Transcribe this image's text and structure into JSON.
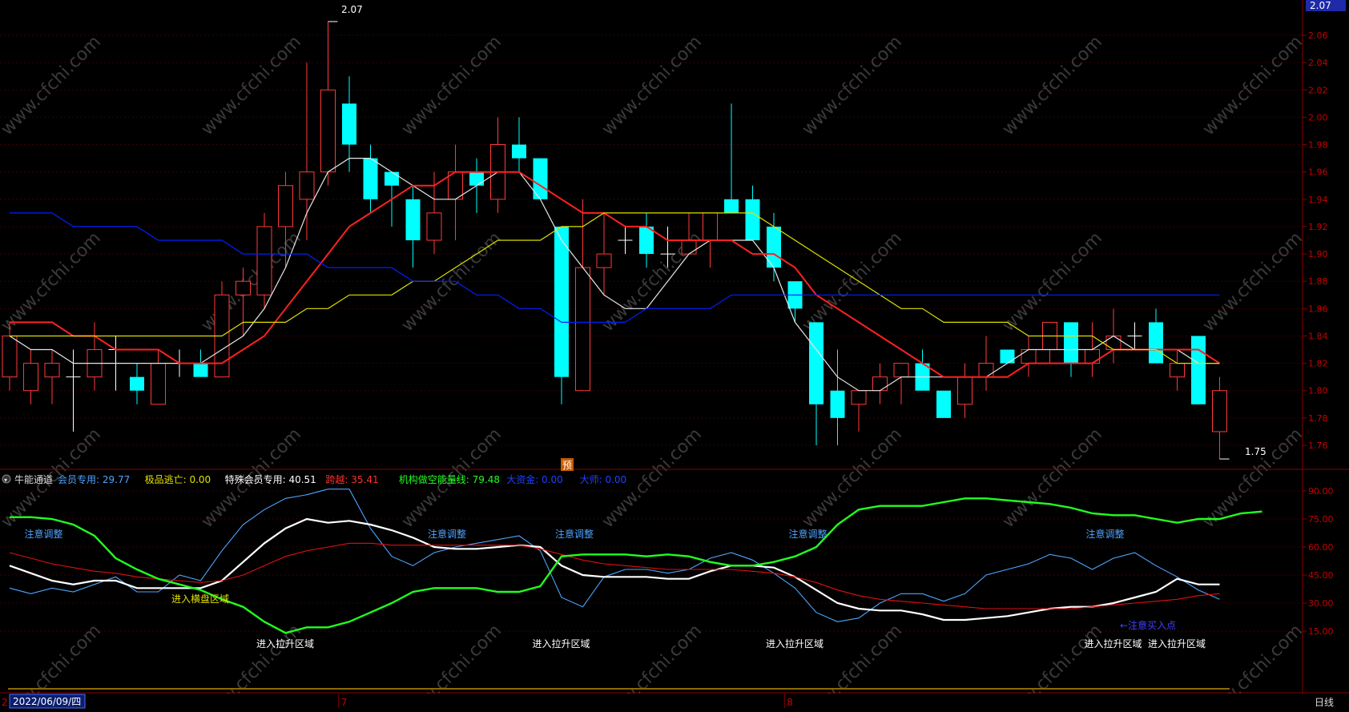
{
  "colors": {
    "bg": "#000000",
    "grid": "#3a0000",
    "frame": "#8a0000",
    "axis_text": "#c80000",
    "up_candle": "#ff3a3a",
    "down_candle": "#00ffff",
    "ma_white": "#e6e6e6",
    "ma_red": "#ff2020",
    "ma_yellow": "#e0e000",
    "ma_blue": "#0020ff",
    "osc_green": "#20ff20",
    "osc_blue": "#4da6ff",
    "osc_white": "#ffffff",
    "osc_red": "#e01010",
    "label_cyan": "#4ea3ff",
    "label_white": "#ffffff",
    "label_yellow": "#e0e000"
  },
  "top_right_price_tag": "2.07",
  "max_marker": "2.07",
  "min_marker": "1.75",
  "forecast_badge": "预",
  "indicator_bar": {
    "name": "牛能通道",
    "items": [
      {
        "label": "会员专用:",
        "value": "29.77",
        "color": "#4ea3ff"
      },
      {
        "label": "极品逃亡:",
        "value": "0.00",
        "color": "#e0e000"
      },
      {
        "label": "特殊会员专用:",
        "value": "40.51",
        "color": "#ffffff"
      },
      {
        "label": "跨越:",
        "value": "35.41",
        "color": "#ff3030"
      },
      {
        "label": "机构做空能量线:",
        "value": "79.48",
        "color": "#20ff20"
      },
      {
        "label": "大资金:",
        "value": "0.00",
        "color": "#2040ff"
      },
      {
        "label": "大师:",
        "value": "0.00",
        "color": "#2040ff"
      }
    ]
  },
  "date_box": "2022/06/09/四",
  "bottom_left_mark": "2",
  "month_labels": [
    {
      "label": "7",
      "index": 16
    },
    {
      "label": "8",
      "index": 37
    }
  ],
  "period_label": "日线",
  "annotations": {
    "attention": "注意调整",
    "enter_lift": "进入拉升区域",
    "enter_sideways": "进入横盘区域",
    "buy_point": "注意买入点"
  },
  "annotation_positions": {
    "attention_at": [
      1,
      20,
      26,
      37,
      51
    ],
    "enter_lift_at": [
      12,
      25,
      36,
      51,
      54
    ],
    "enter_sideways_at": [
      8
    ],
    "buy_point_at": [
      54
    ]
  },
  "watermark": "www.cfchi.com",
  "chart_data": [
    {
      "type": "candlestick",
      "title": "",
      "ylim": [
        1.75,
        2.07
      ],
      "yticks": [
        "2.06",
        "2.04",
        "2.02",
        "2.00",
        "1.98",
        "1.96",
        "1.94",
        "1.92",
        "1.90",
        "1.88",
        "1.86",
        "1.84",
        "1.82",
        "1.80",
        "1.78",
        "1.76"
      ],
      "candles": [
        {
          "o": 1.81,
          "h": 1.85,
          "l": 1.8,
          "c": 1.84
        },
        {
          "o": 1.8,
          "h": 1.83,
          "l": 1.79,
          "c": 1.82
        },
        {
          "o": 1.81,
          "h": 1.83,
          "l": 1.79,
          "c": 1.82
        },
        {
          "o": 1.81,
          "h": 1.83,
          "l": 1.77,
          "c": 1.81
        },
        {
          "o": 1.81,
          "h": 1.85,
          "l": 1.8,
          "c": 1.83
        },
        {
          "o": 1.83,
          "h": 1.84,
          "l": 1.8,
          "c": 1.83
        },
        {
          "o": 1.81,
          "h": 1.82,
          "l": 1.79,
          "c": 1.8
        },
        {
          "o": 1.79,
          "h": 1.83,
          "l": 1.79,
          "c": 1.82
        },
        {
          "o": 1.82,
          "h": 1.83,
          "l": 1.81,
          "c": 1.82
        },
        {
          "o": 1.82,
          "h": 1.83,
          "l": 1.81,
          "c": 1.81
        },
        {
          "o": 1.81,
          "h": 1.88,
          "l": 1.81,
          "c": 1.87
        },
        {
          "o": 1.87,
          "h": 1.89,
          "l": 1.84,
          "c": 1.88
        },
        {
          "o": 1.87,
          "h": 1.93,
          "l": 1.86,
          "c": 1.92
        },
        {
          "o": 1.92,
          "h": 1.96,
          "l": 1.89,
          "c": 1.95
        },
        {
          "o": 1.94,
          "h": 2.04,
          "l": 1.91,
          "c": 1.96
        },
        {
          "o": 1.96,
          "h": 2.07,
          "l": 1.95,
          "c": 2.02
        },
        {
          "o": 2.01,
          "h": 2.03,
          "l": 1.96,
          "c": 1.98
        },
        {
          "o": 1.97,
          "h": 1.98,
          "l": 1.93,
          "c": 1.94
        },
        {
          "o": 1.96,
          "h": 1.96,
          "l": 1.92,
          "c": 1.95
        },
        {
          "o": 1.94,
          "h": 1.95,
          "l": 1.89,
          "c": 1.91
        },
        {
          "o": 1.91,
          "h": 1.96,
          "l": 1.9,
          "c": 1.93
        },
        {
          "o": 1.94,
          "h": 1.98,
          "l": 1.91,
          "c": 1.96
        },
        {
          "o": 1.96,
          "h": 1.97,
          "l": 1.93,
          "c": 1.95
        },
        {
          "o": 1.94,
          "h": 2.0,
          "l": 1.93,
          "c": 1.98
        },
        {
          "o": 1.98,
          "h": 2.0,
          "l": 1.96,
          "c": 1.97
        },
        {
          "o": 1.97,
          "h": 1.97,
          "l": 1.94,
          "c": 1.94
        },
        {
          "o": 1.92,
          "h": 1.92,
          "l": 1.79,
          "c": 1.81
        },
        {
          "o": 1.8,
          "h": 1.94,
          "l": 1.8,
          "c": 1.89
        },
        {
          "o": 1.89,
          "h": 1.93,
          "l": 1.87,
          "c": 1.9
        },
        {
          "o": 1.91,
          "h": 1.92,
          "l": 1.9,
          "c": 1.91
        },
        {
          "o": 1.92,
          "h": 1.93,
          "l": 1.89,
          "c": 1.9
        },
        {
          "o": 1.9,
          "h": 1.92,
          "l": 1.89,
          "c": 1.9
        },
        {
          "o": 1.9,
          "h": 1.93,
          "l": 1.9,
          "c": 1.91
        },
        {
          "o": 1.91,
          "h": 1.93,
          "l": 1.89,
          "c": 1.93
        },
        {
          "o": 1.94,
          "h": 2.01,
          "l": 1.93,
          "c": 1.93
        },
        {
          "o": 1.94,
          "h": 1.95,
          "l": 1.91,
          "c": 1.91
        },
        {
          "o": 1.92,
          "h": 1.93,
          "l": 1.88,
          "c": 1.89
        },
        {
          "o": 1.88,
          "h": 1.88,
          "l": 1.85,
          "c": 1.86
        },
        {
          "o": 1.85,
          "h": 1.85,
          "l": 1.76,
          "c": 1.79
        },
        {
          "o": 1.8,
          "h": 1.83,
          "l": 1.76,
          "c": 1.78
        },
        {
          "o": 1.79,
          "h": 1.8,
          "l": 1.77,
          "c": 1.8
        },
        {
          "o": 1.8,
          "h": 1.82,
          "l": 1.79,
          "c": 1.81
        },
        {
          "o": 1.81,
          "h": 1.82,
          "l": 1.79,
          "c": 1.82
        },
        {
          "o": 1.82,
          "h": 1.83,
          "l": 1.8,
          "c": 1.8
        },
        {
          "o": 1.8,
          "h": 1.8,
          "l": 1.78,
          "c": 1.78
        },
        {
          "o": 1.79,
          "h": 1.82,
          "l": 1.78,
          "c": 1.81
        },
        {
          "o": 1.81,
          "h": 1.84,
          "l": 1.8,
          "c": 1.82
        },
        {
          "o": 1.83,
          "h": 1.83,
          "l": 1.82,
          "c": 1.82
        },
        {
          "o": 1.82,
          "h": 1.84,
          "l": 1.81,
          "c": 1.83
        },
        {
          "o": 1.83,
          "h": 1.85,
          "l": 1.82,
          "c": 1.85
        },
        {
          "o": 1.85,
          "h": 1.85,
          "l": 1.81,
          "c": 1.82
        },
        {
          "o": 1.82,
          "h": 1.85,
          "l": 1.81,
          "c": 1.83
        },
        {
          "o": 1.83,
          "h": 1.86,
          "l": 1.82,
          "c": 1.84
        },
        {
          "o": 1.84,
          "h": 1.85,
          "l": 1.83,
          "c": 1.84
        },
        {
          "o": 1.85,
          "h": 1.86,
          "l": 1.82,
          "c": 1.82
        },
        {
          "o": 1.81,
          "h": 1.83,
          "l": 1.8,
          "c": 1.82
        },
        {
          "o": 1.84,
          "h": 1.84,
          "l": 1.79,
          "c": 1.79
        },
        {
          "o": 1.77,
          "h": 1.81,
          "l": 1.75,
          "c": 1.8
        }
      ],
      "ma_lines": [
        {
          "color_key": "ma_white",
          "values": [
            1.84,
            1.83,
            1.83,
            1.82,
            1.82,
            1.82,
            1.82,
            1.82,
            1.82,
            1.82,
            1.83,
            1.84,
            1.86,
            1.89,
            1.93,
            1.96,
            1.97,
            1.97,
            1.96,
            1.95,
            1.94,
            1.94,
            1.95,
            1.96,
            1.96,
            1.94,
            1.91,
            1.89,
            1.87,
            1.86,
            1.86,
            1.88,
            1.9,
            1.91,
            1.91,
            1.91,
            1.89,
            1.85,
            1.83,
            1.81,
            1.8,
            1.8,
            1.81,
            1.81,
            1.81,
            1.81,
            1.81,
            1.82,
            1.83,
            1.83,
            1.83,
            1.83,
            1.84,
            1.83,
            1.83,
            1.83,
            1.82,
            1.82
          ]
        },
        {
          "color_key": "ma_red",
          "values": [
            1.85,
            1.85,
            1.85,
            1.84,
            1.84,
            1.83,
            1.83,
            1.83,
            1.82,
            1.82,
            1.82,
            1.83,
            1.84,
            1.86,
            1.88,
            1.9,
            1.92,
            1.93,
            1.94,
            1.95,
            1.95,
            1.96,
            1.96,
            1.96,
            1.96,
            1.95,
            1.94,
            1.93,
            1.93,
            1.92,
            1.92,
            1.91,
            1.91,
            1.91,
            1.91,
            1.9,
            1.9,
            1.89,
            1.87,
            1.86,
            1.85,
            1.84,
            1.83,
            1.82,
            1.81,
            1.81,
            1.81,
            1.81,
            1.82,
            1.82,
            1.82,
            1.82,
            1.83,
            1.83,
            1.83,
            1.83,
            1.83,
            1.82
          ]
        },
        {
          "color_key": "ma_yellow",
          "values": [
            1.84,
            1.84,
            1.84,
            1.84,
            1.84,
            1.84,
            1.84,
            1.84,
            1.84,
            1.84,
            1.84,
            1.85,
            1.85,
            1.85,
            1.86,
            1.86,
            1.87,
            1.87,
            1.87,
            1.88,
            1.88,
            1.89,
            1.9,
            1.91,
            1.91,
            1.91,
            1.92,
            1.92,
            1.93,
            1.93,
            1.93,
            1.93,
            1.93,
            1.93,
            1.93,
            1.93,
            1.92,
            1.91,
            1.9,
            1.89,
            1.88,
            1.87,
            1.86,
            1.86,
            1.85,
            1.85,
            1.85,
            1.85,
            1.84,
            1.84,
            1.84,
            1.84,
            1.83,
            1.83,
            1.83,
            1.82,
            1.82,
            1.82
          ]
        },
        {
          "color_key": "ma_blue",
          "values": [
            1.93,
            1.93,
            1.93,
            1.92,
            1.92,
            1.92,
            1.92,
            1.91,
            1.91,
            1.91,
            1.91,
            1.9,
            1.9,
            1.9,
            1.9,
            1.89,
            1.89,
            1.89,
            1.89,
            1.88,
            1.88,
            1.88,
            1.87,
            1.87,
            1.86,
            1.86,
            1.85,
            1.85,
            1.85,
            1.85,
            1.86,
            1.86,
            1.86,
            1.86,
            1.87,
            1.87,
            1.87,
            1.87,
            1.87,
            1.87,
            1.87,
            1.87,
            1.87,
            1.87,
            1.87,
            1.87,
            1.87,
            1.87,
            1.87,
            1.87,
            1.87,
            1.87,
            1.87,
            1.87,
            1.87,
            1.87,
            1.87,
            1.87
          ]
        }
      ]
    },
    {
      "type": "line",
      "title": "",
      "ylim": [
        2,
        100
      ],
      "yticks": [
        "90.00",
        "75.00",
        "60.00",
        "45.00",
        "30.00",
        "15.00"
      ],
      "series": [
        {
          "name": "会员专用",
          "color_key": "osc_blue",
          "values": [
            38,
            35,
            38,
            36,
            40,
            44,
            36,
            36,
            45,
            42,
            58,
            72,
            80,
            86,
            88,
            91,
            91,
            70,
            55,
            50,
            57,
            60,
            62,
            64,
            66,
            58,
            33,
            28,
            44,
            48,
            48,
            46,
            48,
            54,
            57,
            53,
            46,
            38,
            25,
            20,
            22,
            30,
            35,
            35,
            31,
            35,
            45,
            48,
            51,
            56,
            54,
            48,
            54,
            57,
            50,
            44,
            37,
            32
          ]
        },
        {
          "name": "特殊会员专用",
          "color_key": "osc_white",
          "values": [
            50,
            46,
            42,
            40,
            42,
            42,
            38,
            38,
            38,
            38,
            42,
            52,
            62,
            70,
            75,
            73,
            74,
            72,
            69,
            65,
            60,
            59,
            59,
            60,
            61,
            60,
            50,
            45,
            44,
            44,
            44,
            43,
            43,
            47,
            50,
            50,
            49,
            44,
            37,
            30,
            27,
            26,
            26,
            24,
            21,
            21,
            22,
            23,
            25,
            27,
            28,
            28,
            30,
            33,
            36,
            43,
            40,
            40
          ]
        },
        {
          "name": "跨越",
          "color_key": "osc_red",
          "values": [
            57,
            54,
            51,
            49,
            47,
            46,
            44,
            43,
            42,
            41,
            42,
            45,
            50,
            55,
            58,
            60,
            62,
            62,
            61,
            61,
            61,
            61,
            61,
            61,
            61,
            59,
            56,
            53,
            51,
            50,
            49,
            48,
            48,
            48,
            48,
            47,
            46,
            44,
            41,
            37,
            34,
            32,
            31,
            30,
            29,
            28,
            27,
            27,
            27,
            27,
            27,
            28,
            29,
            30,
            31,
            32,
            34,
            35
          ]
        },
        {
          "name": "机构做空能量线",
          "color_key": "osc_green",
          "values": [
            76,
            76,
            75,
            72,
            66,
            54,
            48,
            43,
            40,
            37,
            32,
            28,
            20,
            14,
            17,
            17,
            20,
            25,
            30,
            36,
            38,
            38,
            38,
            36,
            36,
            39,
            55,
            56,
            56,
            56,
            55,
            56,
            55,
            52,
            50,
            50,
            52,
            55,
            60,
            72,
            80,
            82,
            82,
            82,
            84,
            86,
            86,
            85,
            84,
            83,
            81,
            78,
            77,
            77,
            75,
            73,
            75,
            75,
            78,
            79
          ]
        }
      ]
    }
  ]
}
